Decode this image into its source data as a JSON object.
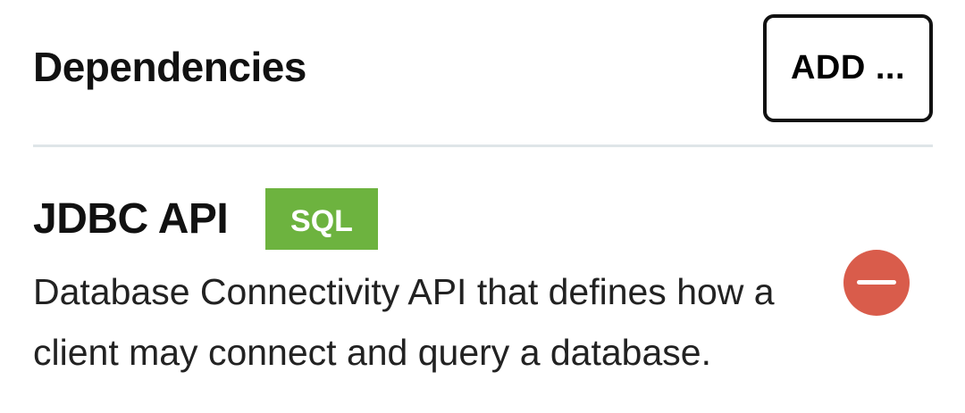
{
  "dependencies": {
    "title": "Dependencies",
    "add_label": "ADD ...",
    "items": [
      {
        "name": "JDBC API",
        "tag": "SQL",
        "description": "Database Connectivity API that defines how a client may connect and query a database.",
        "remove_icon": "minus-circle-icon"
      }
    ]
  },
  "colors": {
    "tag_background": "#6db33f",
    "remove_button": "#d95c4b",
    "divider": "#dfe5e8"
  }
}
